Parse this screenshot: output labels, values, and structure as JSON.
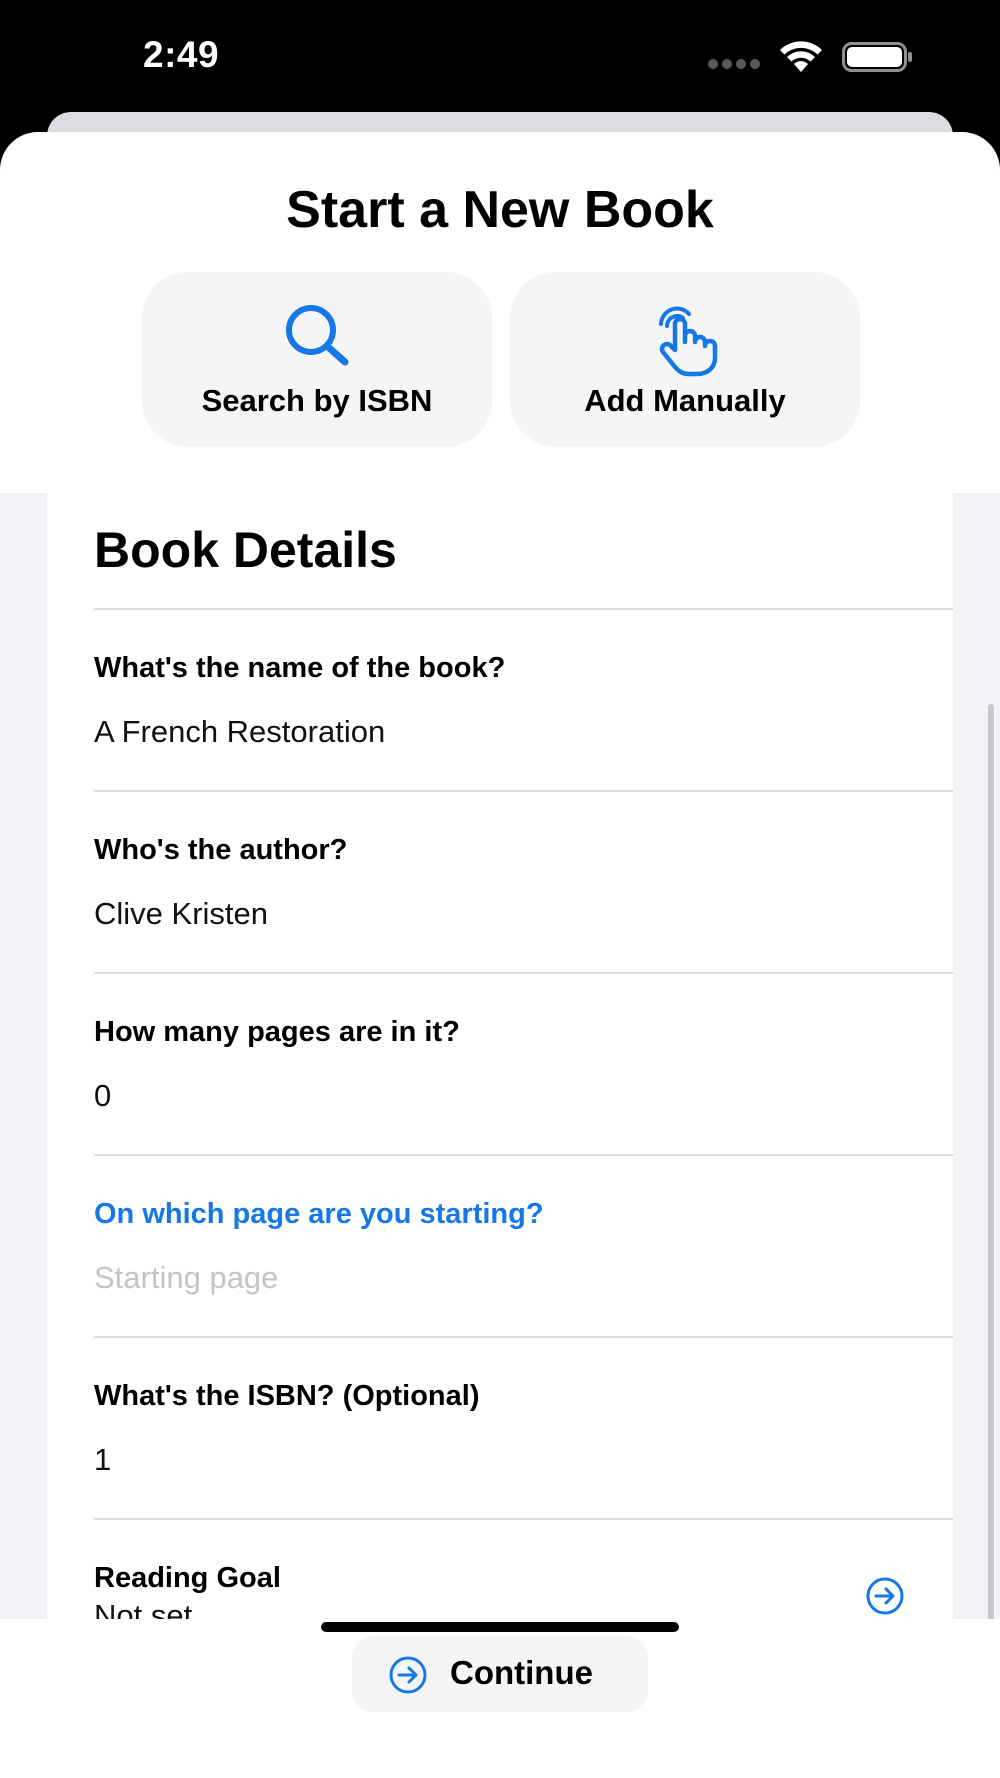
{
  "status_bar": {
    "time": "2:49"
  },
  "sheet": {
    "title": "Start a New Book",
    "modes": [
      {
        "label": "Search by ISBN",
        "icon": "magnifying-glass-icon"
      },
      {
        "label": "Add Manually",
        "icon": "hand-tap-icon"
      }
    ]
  },
  "form": {
    "section_title": "Book Details",
    "fields": [
      {
        "question": "What's the name of the book?",
        "value": "A French Restoration",
        "placeholder": ""
      },
      {
        "question": "Who's the author?",
        "value": "Clive Kristen",
        "placeholder": ""
      },
      {
        "question": "How many pages are in it?",
        "value": "0",
        "placeholder": ""
      },
      {
        "question": "On which page are you starting?",
        "value": "",
        "placeholder": "Starting page",
        "focused": true
      },
      {
        "question": "What's the ISBN? (Optional)",
        "value": "1",
        "placeholder": ""
      }
    ],
    "reading_goal": {
      "label": "Reading Goal",
      "value": "Not set",
      "icon": "arrow-circle-right-icon"
    }
  },
  "footer": {
    "continue_label": "Continue",
    "continue_icon": "arrow-circle-right-icon"
  },
  "colors": {
    "accent": "#1677E6",
    "placeholder": "#C4C4C8",
    "background": "#F2F2F7",
    "button_bg": "#F5F5F7"
  }
}
